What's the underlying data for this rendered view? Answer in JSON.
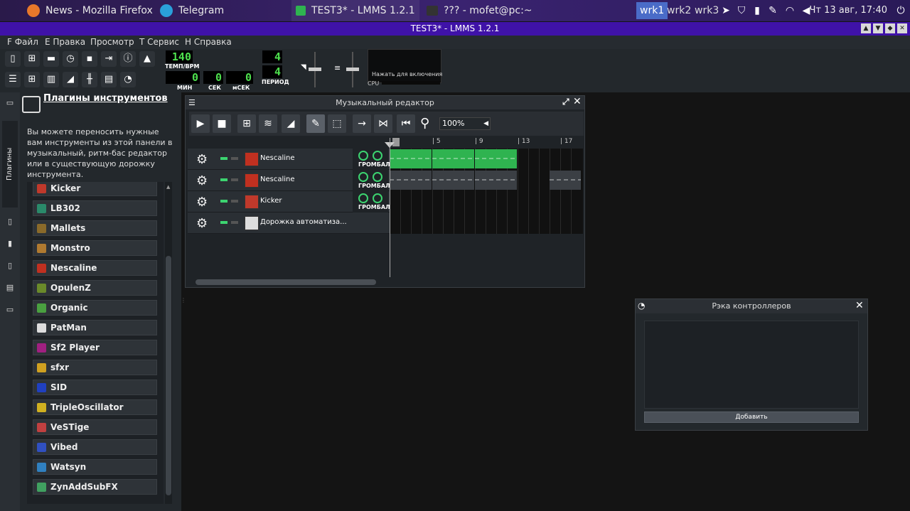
{
  "taskbar": {
    "tasks": [
      {
        "label": "News - Mozilla Firefox",
        "icon": "firefox-icon"
      },
      {
        "label": "Telegram",
        "icon": "telegram-icon"
      },
      {
        "label": "TEST3* - LMMS 1.2.1",
        "icon": "lmms-icon"
      },
      {
        "label": "??? - mofet@pc:~",
        "icon": "terminal-icon"
      }
    ],
    "workspaces": [
      "wrk1",
      "wrk2",
      "wrk3"
    ],
    "active_workspace": "wrk1",
    "clock": "Чт 13 авг, 17:40"
  },
  "window": {
    "title": "TEST3* - LMMS 1.2.1"
  },
  "menu": {
    "items": [
      "F Файл",
      "E Правка",
      "Просмотр",
      "T Сервис",
      "H Справка"
    ]
  },
  "toolbar": {
    "tempo_value": "140",
    "tempo_label": "ТЕМП/BPM",
    "min_value": "0",
    "sec_value": "0",
    "msec_value": "0",
    "min_label": "МИН",
    "sec_label": "СЕК",
    "msec_label": "мСЕК",
    "time_sig_num": "4",
    "time_sig_den": "4",
    "period_label": "ПЕРИОД",
    "cpu_hint": "Нажать для включения",
    "cpu_label": "CPU"
  },
  "sidebar": {
    "vertical_tab": "Плагины инструментов"
  },
  "plugins_panel": {
    "title": "Плагины инструментов",
    "description": "Вы можете переносить нужные вам инструменты из этой панели в музыкальный, ритм-бас редактор или в существующую дорожку инструмента.",
    "plugins": [
      {
        "name": "Kicker",
        "color": "#c0392b"
      },
      {
        "name": "LB302",
        "color": "#2a8a6a"
      },
      {
        "name": "Mallets",
        "color": "#8a6a2a"
      },
      {
        "name": "Monstro",
        "color": "#b07a30"
      },
      {
        "name": "Nescaline",
        "color": "#c03020"
      },
      {
        "name": "OpulenZ",
        "color": "#6a8a2a"
      },
      {
        "name": "Organic",
        "color": "#4aa040"
      },
      {
        "name": "PatMan",
        "color": "#dddddd"
      },
      {
        "name": "Sf2 Player",
        "color": "#a02080"
      },
      {
        "name": "sfxr",
        "color": "#d0a020"
      },
      {
        "name": "SID",
        "color": "#2040c0"
      },
      {
        "name": "TripleOscillator",
        "color": "#d0b020"
      },
      {
        "name": "VeSTige",
        "color": "#c04040"
      },
      {
        "name": "Vibed",
        "color": "#3050c0"
      },
      {
        "name": "Watsyn",
        "color": "#3080c0"
      },
      {
        "name": "ZynAddSubFX",
        "color": "#40a060"
      }
    ]
  },
  "song_editor": {
    "title": "Музыкальный редактор",
    "zoom": "100%",
    "ruler": [
      "1",
      "5",
      "9",
      "13",
      "17"
    ],
    "tracks": [
      {
        "name": "Nescaline",
        "type": "instrument",
        "knob_label": "ГРОМБАЛ",
        "patterns": [
          [
            0,
            4,
            "active"
          ],
          [
            4,
            8,
            "active"
          ],
          [
            8,
            12,
            "active"
          ]
        ]
      },
      {
        "name": "Nescaline",
        "type": "instrument",
        "knob_label": "ГРОМБАЛ",
        "patterns": [
          [
            0,
            4,
            "muted"
          ],
          [
            4,
            8,
            "muted"
          ],
          [
            8,
            12,
            "muted"
          ],
          [
            15,
            18,
            "muted"
          ]
        ]
      },
      {
        "name": "Kicker",
        "type": "instrument",
        "knob_label": "ГРОМБАЛ",
        "patterns": []
      },
      {
        "name": "Дорожка автоматиза...",
        "type": "automation",
        "knob_label": "",
        "patterns": []
      }
    ],
    "colors": {
      "active_pattern": "#2fb350",
      "muted_pattern": "#3b3f44"
    }
  },
  "controller_rack": {
    "title": "Рэка контроллеров",
    "add_label": "Добавить"
  }
}
